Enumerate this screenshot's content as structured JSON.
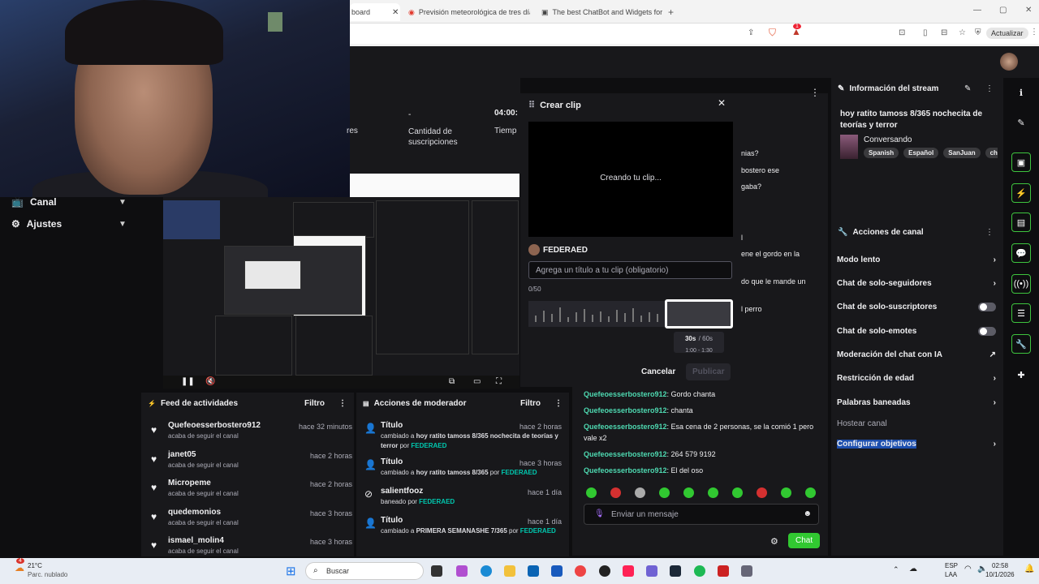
{
  "browser": {
    "tabs": [
      {
        "label": "board"
      },
      {
        "label": "Previsión meteorológica de tres días"
      },
      {
        "label": "The best ChatBot and Widgets for K"
      }
    ],
    "new_tab_label": "+",
    "update_label": "Actualizar",
    "notif_count": "1"
  },
  "left_nav": {
    "items": [
      {
        "label": "Canal"
      },
      {
        "label": "Ajustes"
      }
    ]
  },
  "stats": {
    "dash": "-",
    "subs_label": "Cantidad de suscripciones",
    "partial_left": "res",
    "time": "04:00:",
    "time_label": "Tiemp"
  },
  "clip": {
    "title": "Crear clip",
    "status": "Creando tu clip...",
    "user": "FEDERAED",
    "placeholder": "Agrega un título a tu clip (obligatorio)",
    "counter": "0/50",
    "length_main": "30s",
    "length_total": "/ 60s",
    "range": "1:00 - 1:30",
    "cancel": "Cancelar",
    "publish": "Publicar"
  },
  "chat": {
    "partial_lines": [
      "nias?",
      "bostero ese",
      "gaba?",
      "l",
      "ene el gordo en la",
      "do que le mande un",
      "l perro"
    ],
    "messages": [
      {
        "user": "Quefeoesserbostero912",
        "text": ": Gordo chanta"
      },
      {
        "user": "Quefeoesserbostero912",
        "text": ": chanta"
      },
      {
        "user": "Quefeoesserbostero912",
        "text": ": Esa cena de 2 personas, se la comió 1 pero vale x2"
      },
      {
        "user": "Quefeoesserbostero912",
        "text": ": 264 579 9192"
      },
      {
        "user": "Quefeoesserbostero912",
        "text": ": El del oso"
      }
    ],
    "input_placeholder": "Enviar un mensaje",
    "send_label": "Chat"
  },
  "activity": {
    "title": "Feed de actividades",
    "filter": "Filtro",
    "items": [
      {
        "name": "Quefeoesserbostero912",
        "sub": "acaba de seguir el canal",
        "time": "hace 32 minutos"
      },
      {
        "name": "janet05",
        "sub": "acaba de seguir el canal",
        "time": "hace 2 horas"
      },
      {
        "name": "Micropeme",
        "sub": "acaba de seguir el canal",
        "time": "hace 2 horas"
      },
      {
        "name": "quedemonios",
        "sub": "acaba de seguir el canal",
        "time": "hace 3 horas"
      },
      {
        "name": "ismael_molin4",
        "sub": "acaba de seguir el canal",
        "time": "hace 3 horas"
      }
    ]
  },
  "modactions": {
    "title": "Acciones de moderador",
    "filter": "Filtro",
    "items": [
      {
        "name": "Título",
        "pre": "cambiado a ",
        "bold": "hoy ratito tamoss 8/365 nochecita de teorías y terror",
        "mid": " por ",
        "by": "FEDERAED",
        "time": "hace 2 horas"
      },
      {
        "name": "Título",
        "pre": "cambiado a ",
        "bold": "hoy ratito tamoss 8/365",
        "mid": " por ",
        "by": "FEDERAED",
        "time": "hace 3 horas"
      },
      {
        "name": "salientfooz",
        "pre": "baneado",
        "bold": "",
        "mid": " por ",
        "by": "FEDERAED",
        "time": "hace 1 día"
      },
      {
        "name": "Título",
        "pre": "cambiado a ",
        "bold": "PRIMERA SEMANASHE 7/365",
        "mid": " por ",
        "by": "FEDERAED",
        "time": "hace 1 día"
      }
    ]
  },
  "stream_info": {
    "title": "Información del stream",
    "stream_title": "hoy ratito tamoss 8/365 nochecita de teorías y terror",
    "category": "Conversando",
    "tags": [
      "Spanish",
      "Español",
      "SanJuan",
      "chil"
    ]
  },
  "channel_actions": {
    "title": "Acciones de canal",
    "items": [
      {
        "label": "Modo lento",
        "control": "chevron"
      },
      {
        "label": "Chat de solo-seguidores",
        "control": "chevron"
      },
      {
        "label": "Chat de solo-suscriptores",
        "control": "toggle"
      },
      {
        "label": "Chat de solo-emotes",
        "control": "toggle"
      },
      {
        "label": "Moderación del chat con IA",
        "control": "external"
      },
      {
        "label": "Restricción de edad",
        "control": "chevron"
      },
      {
        "label": "Palabras baneadas",
        "control": "chevron"
      },
      {
        "label": "Hostear canal",
        "control": "none"
      },
      {
        "label": "Configurar objetivos",
        "control": "chevron"
      }
    ]
  },
  "taskbar": {
    "temp": "21°C",
    "weather": "Parc. nublado",
    "search": "Buscar",
    "lang1": "ESP",
    "lang2": "LAA",
    "time": "02:58",
    "date": "10/1/2026",
    "badge": "4"
  },
  "colors": {
    "accent": "#31c831",
    "bg": "#0e0e10",
    "panel": "#18181b",
    "link": "#4ed9b1"
  }
}
